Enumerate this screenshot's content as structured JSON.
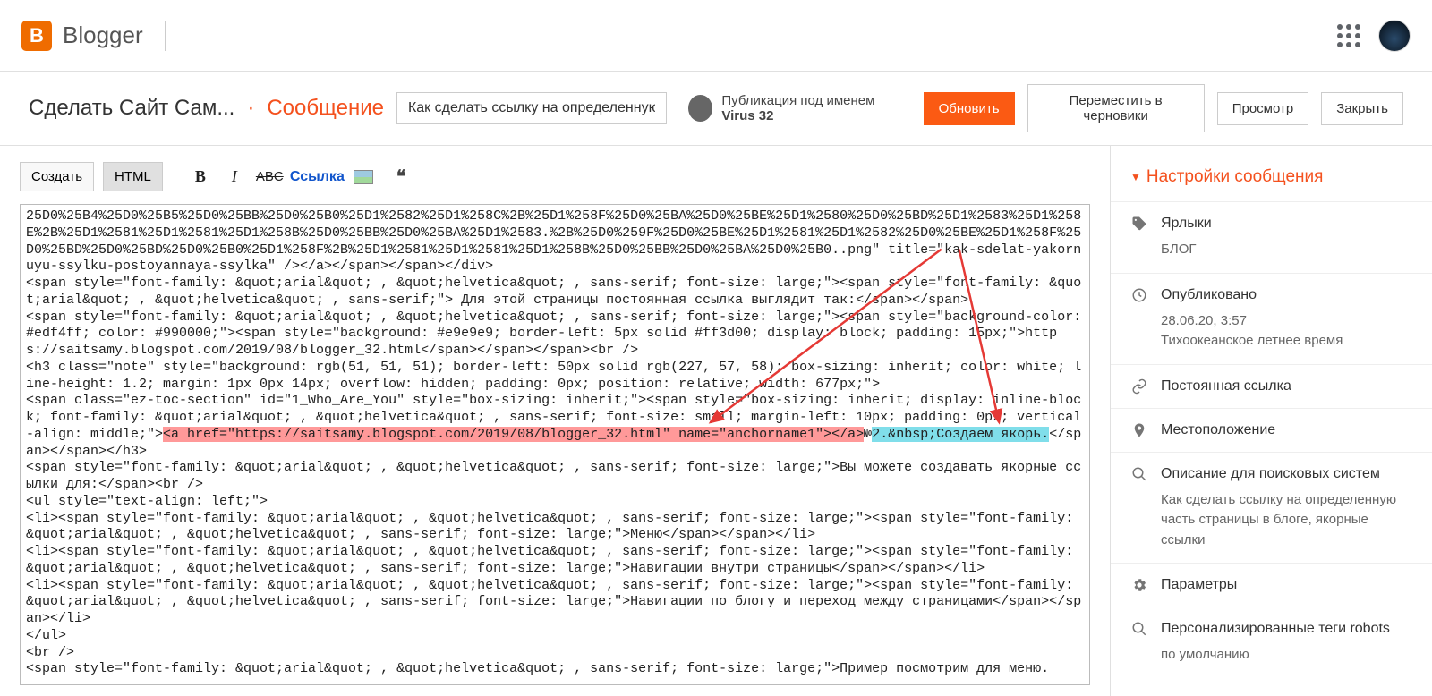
{
  "brand": "Blogger",
  "breadcrumb": {
    "site": "Сделать Сайт Сам...",
    "section": "Сообщение"
  },
  "post_title_input": "Как сделать ссылку на определенную час",
  "author_prefix": "Публикация под именем ",
  "author_name": "Virus 32",
  "buttons": {
    "update": "Обновить",
    "draft": "Переместить в черновики",
    "preview": "Просмотр",
    "close": "Закрыть"
  },
  "toolbar": {
    "compose": "Создать",
    "html": "HTML",
    "link": "Ссылка"
  },
  "code": {
    "part1": "25D0%25B4%25D0%25B5%25D0%25BB%25D0%25B0%25D1%2582%25D1%258C%2B%25D1%258F%25D0%25BA%25D0%25BE%25D1%2580%25D0%25BD%25D1%2583%25D1%258E%2B%25D1%2581%25D1%2581%25D1%258B%25D0%25BB%25D0%25BA%25D1%2583.%2B%25D0%259F%25D0%25BE%25D1%2581%25D1%2582%25D0%25BE%25D1%258F%25D0%25BD%25D0%25BD%25D0%25B0%25D1%258F%2B%25D1%2581%25D1%2581%25D1%258B%25D0%25BB%25D0%25BA%25D0%25B0..png\" title=\"kak-sdelat-yakornuyu-ssylku-postoyannaya-ssylka\" /></a></span></span></div>\n<span style=\"font-family: &quot;arial&quot; , &quot;helvetica&quot; , sans-serif; font-size: large;\"><span style=\"font-family: &quot;arial&quot; , &quot;helvetica&quot; , sans-serif;\"> Для этой страницы постоянная ссылка выглядит так:</span></span>\n<span style=\"font-family: &quot;arial&quot; , &quot;helvetica&quot; , sans-serif; font-size: large;\"><span style=\"background-color: #edf4ff; color: #990000;\"><span style=\"background: #e9e9e9; border-left: 5px solid #ff3d00; display: block; padding: 15px;\">https://saitsamy.blogspot.com/2019/08/blogger_32.html</span></span></span><br />\n<h3 class=\"note\" style=\"background: rgb(51, 51, 51); border-left: 50px solid rgb(227, 57, 58); box-sizing: inherit; color: white; line-height: 1.2; margin: 1px 0px 14px; overflow: hidden; padding: 0px; position: relative; width: 677px;\">\n<span class=\"ez-toc-section\" id=\"1_Who_Are_You\" style=\"box-sizing: inherit;\"><span style=\"box-sizing: inherit; display: inline-block; font-family: &quot;arial&quot; , &quot;helvetica&quot; , sans-serif; font-size: small; margin-left: 10px; padding: 0px; vertical-align: middle;\">",
    "hl_red": "<a href=\"https://saitsamy.blogspot.com/2019/08/blogger_32.html\" name=\"anchorname1\"></a>",
    "mid": "№",
    "hl_teal1": "2.&nbsp;Создаем якорь.",
    "part2": "</span></span></h3>\n<span style=\"font-family: &quot;arial&quot; , &quot;helvetica&quot; , sans-serif; font-size: large;\">Вы можете создавать якорные ссылки для:</span><br />\n<ul style=\"text-align: left;\">\n<li><span style=\"font-family: &quot;arial&quot; , &quot;helvetica&quot; , sans-serif; font-size: large;\"><span style=\"font-family: &quot;arial&quot; , &quot;helvetica&quot; , sans-serif; font-size: large;\">Меню</span></span></li>\n<li><span style=\"font-family: &quot;arial&quot; , &quot;helvetica&quot; , sans-serif; font-size: large;\"><span style=\"font-family: &quot;arial&quot; , &quot;helvetica&quot; , sans-serif; font-size: large;\">Навигации внутри страницы</span></span></li>\n<li><span style=\"font-family: &quot;arial&quot; , &quot;helvetica&quot; , sans-serif; font-size: large;\"><span style=\"font-family: &quot;arial&quot; , &quot;helvetica&quot; , sans-serif; font-size: large;\">Навигации по блогу и переход между страницами</span></span></li>\n</ul>\n<br />\n<span style=\"font-family: &quot;arial&quot; , &quot;helvetica&quot; , sans-serif; font-size: large;\">Пример посмотрим для меню."
  },
  "sidebar": {
    "title": "Настройки сообщения",
    "labels": {
      "head": "Ярлыки",
      "value": "БЛОГ"
    },
    "published": {
      "head": "Опубликовано",
      "date": "28.06.20, 3:57",
      "tz": "Тихоокеанское летнее время"
    },
    "permalink": "Постоянная ссылка",
    "location": "Местоположение",
    "search_desc": {
      "head": "Описание для поисковых систем",
      "value": "Как сделать ссылку на определенную часть страницы в блоге, якорные ссылки"
    },
    "options": "Параметры",
    "robots": {
      "head": "Персонализированные теги robots",
      "value": "по умолчанию"
    }
  }
}
